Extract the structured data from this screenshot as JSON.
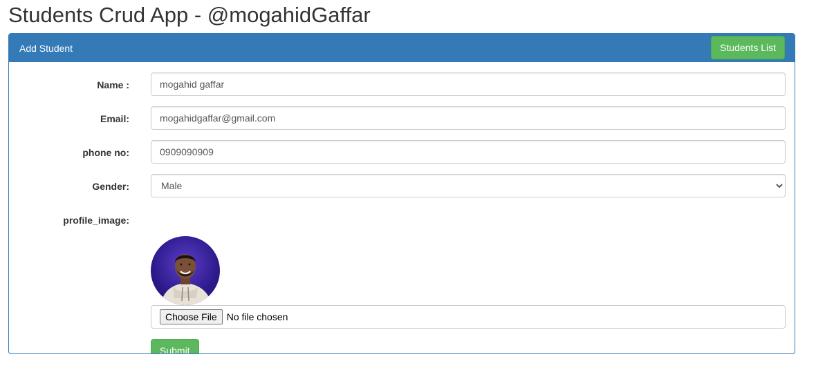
{
  "page": {
    "title": "Students Crud App - @mogahidGaffar"
  },
  "panel": {
    "heading": "Add Student",
    "students_list_label": "Students List"
  },
  "form": {
    "name_label": "Name :",
    "name_value": "mogahid gaffar",
    "email_label": "Email:",
    "email_value": "mogahidgaffar@gmail.com",
    "phone_label": "phone no:",
    "phone_value": "0909090909",
    "gender_label": "Gender:",
    "gender_selected": "Male",
    "profile_image_label": "profile_image:",
    "choose_file_label": "Choose File",
    "file_status": "No file chosen",
    "submit_label": "Submit"
  },
  "colors": {
    "primary": "#337ab7",
    "success": "#5cb85c"
  }
}
